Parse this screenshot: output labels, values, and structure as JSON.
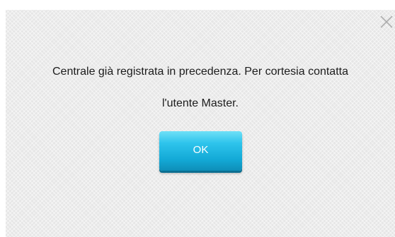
{
  "dialog": {
    "message_line1": "Centrale già registrata in precedenza. Per cortesia contatta",
    "message_line2": "l'utente Master.",
    "ok_label": "OK",
    "close_icon": "close-icon"
  },
  "colors": {
    "dialog_background": "#e6e6e6",
    "button_accent": "#1bb5e0",
    "text": "#1c1c1c"
  }
}
